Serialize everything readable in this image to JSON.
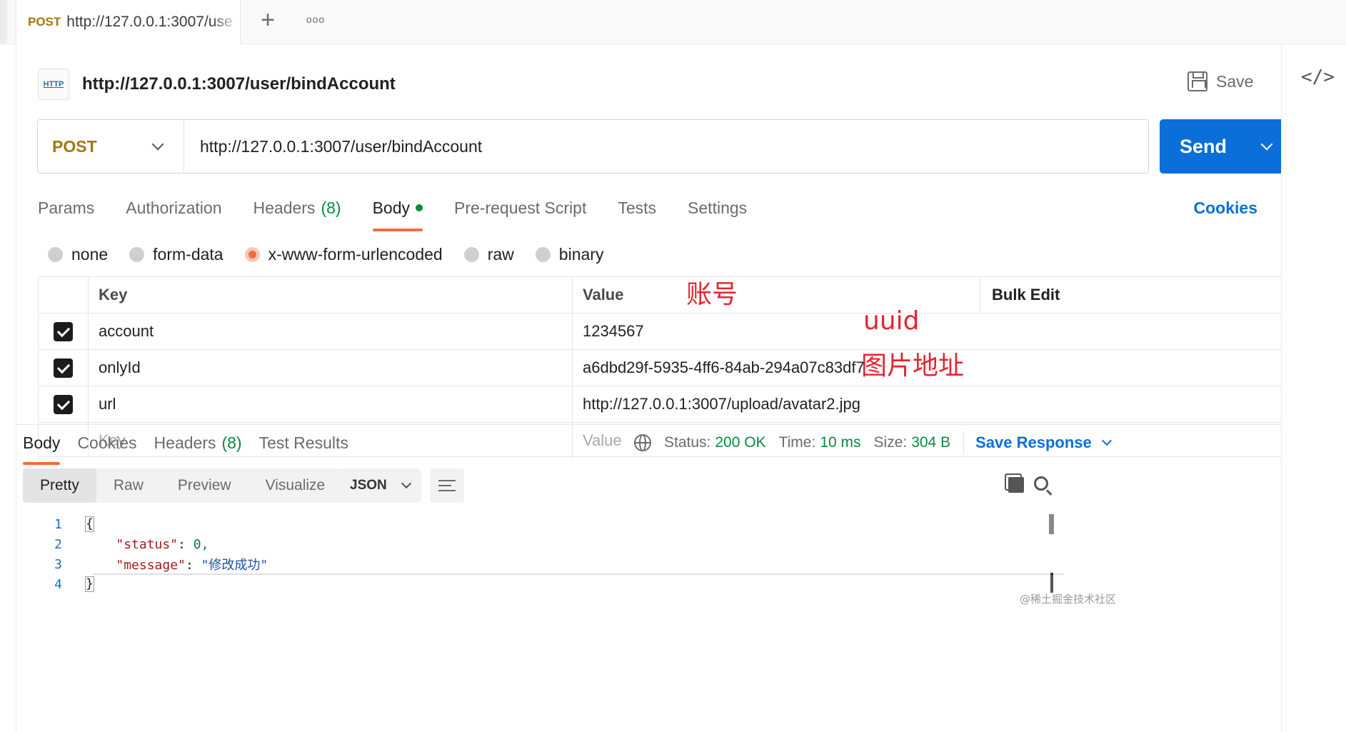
{
  "tab": {
    "method": "POST",
    "url": "http://127.0.0.1:3007/use",
    "more_label": "ooo"
  },
  "request": {
    "title": "http://127.0.0.1:3007/user/bindAccount",
    "http_badge": "HTTP",
    "save_label": "Save",
    "method": "POST",
    "url": "http://127.0.0.1:3007/user/bindAccount",
    "send_label": "Send"
  },
  "req_tabs": {
    "params": "Params",
    "authorization": "Authorization",
    "headers": "Headers",
    "headers_count": "(8)",
    "body": "Body",
    "prerequest": "Pre-request Script",
    "tests": "Tests",
    "settings": "Settings",
    "cookies": "Cookies"
  },
  "body_types": [
    "none",
    "form-data",
    "x-www-form-urlencoded",
    "raw",
    "binary"
  ],
  "body_type_selected": "x-www-form-urlencoded",
  "kv_table": {
    "header_key": "Key",
    "header_value": "Value",
    "bulk_edit": "Bulk Edit",
    "rows": [
      {
        "key": "account",
        "value": "1234567",
        "note": "账号"
      },
      {
        "key": "onlyId",
        "value": "a6dbd29f-5935-4ff6-84ab-294a07c83df7",
        "note": "uuid"
      },
      {
        "key": "url",
        "value": "http://127.0.0.1:3007/upload/avatar2.jpg",
        "note": "图片地址"
      }
    ],
    "placeholder_key": "Key",
    "placeholder_value": "Value"
  },
  "response": {
    "tabs": {
      "body": "Body",
      "cookies": "Cookies",
      "headers": "Headers",
      "headers_count": "(8)",
      "test_results": "Test Results"
    },
    "status_label": "Status:",
    "status_value": "200 OK",
    "time_label": "Time:",
    "time_value": "10 ms",
    "size_label": "Size:",
    "size_value": "304 B",
    "save_response": "Save Response",
    "views": [
      "Pretty",
      "Raw",
      "Preview",
      "Visualize"
    ],
    "format": "JSON",
    "code_lines": [
      {
        "n": "1",
        "text": "{"
      },
      {
        "n": "2",
        "key": "\"status\"",
        "value": "0,"
      },
      {
        "n": "3",
        "key": "\"message\"",
        "value": "\"修改成功\""
      },
      {
        "n": "4",
        "text": "}"
      }
    ]
  },
  "watermark": "@稀土掘金技术社区",
  "colors": {
    "accent": "#0b6fd9",
    "method": "#a0780a",
    "active_tab": "#f26b3a",
    "status_ok": "#0a8a3e",
    "annotation": "#e3262f"
  }
}
